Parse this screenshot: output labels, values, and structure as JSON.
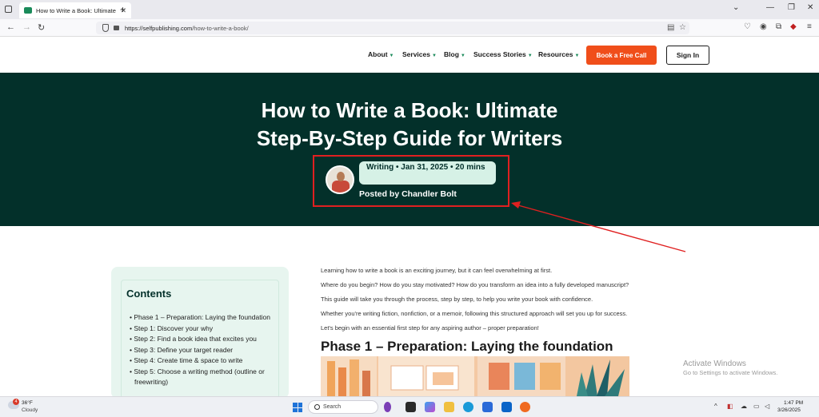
{
  "browser": {
    "tab_title": "How to Write a Book: Ultimate",
    "url_host": "https://selfpublishing.com",
    "url_path": "/how-to-write-a-book/"
  },
  "site": {
    "nav": [
      {
        "label": "About"
      },
      {
        "label": "Services"
      },
      {
        "label": "Blog"
      },
      {
        "label": "Success Stories"
      },
      {
        "label": "Resources"
      }
    ],
    "cta_label": "Book a Free Call",
    "signin_label": "Sign In"
  },
  "hero": {
    "title_line1": "How to Write a Book: Ultimate",
    "title_line2": "Step-By-Step Guide for Writers",
    "meta": "Writing • Jan 31, 2025 • 20 mins",
    "posted_by": "Posted by Chandler Bolt"
  },
  "toc": {
    "title": "Contents",
    "items": [
      "• Phase 1 – Preparation: Laying the foundation",
      "• Step 1: Discover your why",
      "• Step 2: Find a book idea that excites you",
      "• Step 3: Define your target reader",
      "• Step 4: Create time & space to write",
      "• Step 5: Choose a writing method (outline or freewriting)"
    ]
  },
  "article": {
    "paragraphs": [
      "Learning how to write a book is an exciting journey, but it can feel overwhelming at first.",
      "Where do you begin? How do you stay motivated? How do you transform an idea into a fully developed manuscript?",
      "This guide will take you through the process, step by step, to help you write your book with confidence.",
      "Whether you're writing fiction, nonfiction, or a memoir, following this structured approach will set you up for success.",
      "Let's begin with an essential first step for any aspiring author – proper preparation!"
    ],
    "heading": "Phase 1 – Preparation: Laying the foundation"
  },
  "watermark": {
    "title": "Activate Windows",
    "subtitle": "Go to Settings to activate Windows."
  },
  "taskbar": {
    "weather_badge": "4",
    "temperature": "36°F",
    "condition": "Cloudy",
    "search_placeholder": "Search",
    "time": "1:47 PM",
    "date": "3/26/2025"
  },
  "colors": {
    "hero_bg": "#03302a",
    "cta_bg": "#f04e1a",
    "annotation_red": "#e02020",
    "meta_pill": "#d6f1e6",
    "toc_bg": "#e7f5ef"
  }
}
